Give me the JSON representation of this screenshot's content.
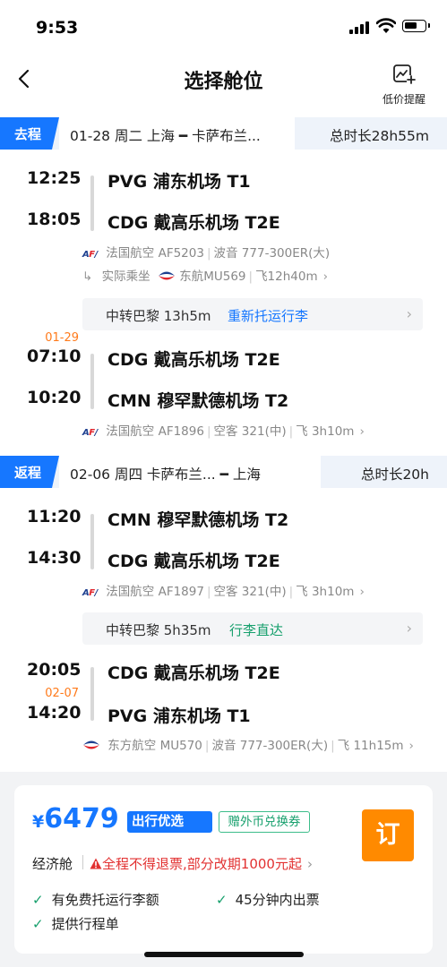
{
  "status": {
    "time": "9:53"
  },
  "nav": {
    "title": "选择舱位",
    "alert_label": "低价提醒"
  },
  "outbound": {
    "tag": "去程",
    "route": "01-28 周二 上海 ━ 卡萨布兰...",
    "duration": "总时长28h55m",
    "leg1": {
      "dep_time": "12:25",
      "dep_airport": "PVG 浦东机场 T1",
      "arr_time": "18:05",
      "arr_airport": "CDG 戴高乐机场 T2E",
      "airline": "法国航空 AF5203",
      "aircraft": "波音 777-300ER(大)",
      "actual_label": "实际乘坐",
      "actual_flight": "东航MU569",
      "fly_time": "飞12h40m"
    },
    "transfer": {
      "text": "中转巴黎 13h5m",
      "note": "重新托运行李"
    },
    "leg2": {
      "date_note": "01-29",
      "dep_time": "07:10",
      "dep_airport": "CDG 戴高乐机场 T2E",
      "arr_time": "10:20",
      "arr_airport": "CMN 穆罕默德机场 T2",
      "airline": "法国航空 AF1896",
      "aircraft": "空客 321(中)",
      "fly_time": "飞 3h10m"
    }
  },
  "return": {
    "tag": "返程",
    "route": "02-06 周四 卡萨布兰... ━ 上海",
    "duration": "总时长20h",
    "leg1": {
      "dep_time": "11:20",
      "dep_airport": "CMN 穆罕默德机场 T2",
      "arr_time": "14:30",
      "arr_airport": "CDG 戴高乐机场 T2E",
      "airline": "法国航空 AF1897",
      "aircraft": "空客 321(中)",
      "fly_time": "飞 3h10m"
    },
    "transfer": {
      "text": "中转巴黎 5h35m",
      "note": "行李直达"
    },
    "leg2": {
      "date_note": "02-07",
      "dep_time": "20:05",
      "dep_airport": "CDG 戴高乐机场 T2E",
      "arr_time": "14:20",
      "arr_airport": "PVG 浦东机场 T1",
      "airline": "东方航空 MU570",
      "aircraft": "波音 777-300ER(大)",
      "fly_time": "飞 11h15m"
    }
  },
  "offer": {
    "currency": "¥",
    "price": "6479",
    "badge": "出行优选",
    "coupon": "赠外币兑换券",
    "book_label": "订",
    "cabin": "经济舱",
    "policy": "全程不得退票,部分改期1000元起",
    "features": [
      "有免费托运行李额",
      "45分钟内出票",
      "提供行程单"
    ]
  },
  "colors": {
    "accent": "#1677ff",
    "orange": "#ff8a00",
    "green": "#17a06d",
    "red": "#e23131",
    "date_orange": "#ff7a1a"
  }
}
